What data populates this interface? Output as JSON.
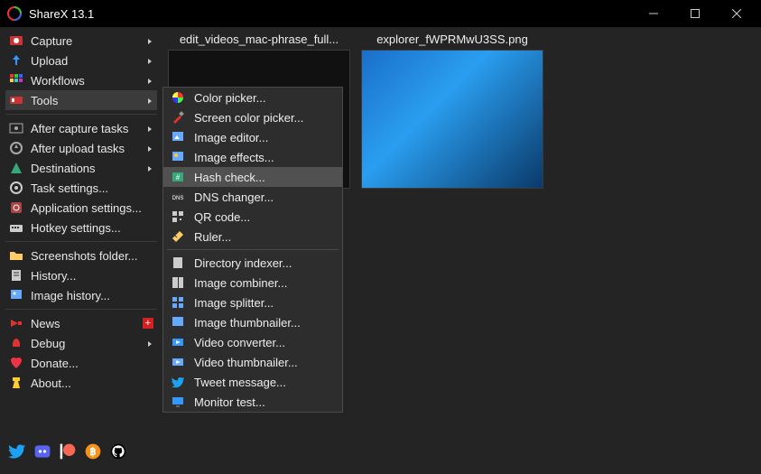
{
  "title": "ShareX 13.1",
  "sidebar": {
    "items": [
      {
        "label": "Capture",
        "icon": "capture",
        "arrow": true
      },
      {
        "label": "Upload",
        "icon": "upload",
        "arrow": true
      },
      {
        "label": "Workflows",
        "icon": "workflows",
        "arrow": true
      },
      {
        "label": "Tools",
        "icon": "tools",
        "arrow": true,
        "hover": true
      }
    ],
    "items2": [
      {
        "label": "After capture tasks",
        "icon": "aftercap",
        "arrow": true
      },
      {
        "label": "After upload tasks",
        "icon": "afterup",
        "arrow": true
      },
      {
        "label": "Destinations",
        "icon": "dest",
        "arrow": true
      },
      {
        "label": "Task settings...",
        "icon": "task",
        "arrow": false
      },
      {
        "label": "Application settings...",
        "icon": "app",
        "arrow": false
      },
      {
        "label": "Hotkey settings...",
        "icon": "hotkey",
        "arrow": false
      }
    ],
    "items3": [
      {
        "label": "Screenshots folder...",
        "icon": "folder",
        "arrow": false
      },
      {
        "label": "History...",
        "icon": "history",
        "arrow": false
      },
      {
        "label": "Image history...",
        "icon": "imghist",
        "arrow": false
      }
    ],
    "items4": [
      {
        "label": "News",
        "icon": "news",
        "arrow": false,
        "badge": "+"
      },
      {
        "label": "Debug",
        "icon": "debug",
        "arrow": true
      },
      {
        "label": "Donate...",
        "icon": "donate",
        "arrow": false
      },
      {
        "label": "About...",
        "icon": "about",
        "arrow": false
      }
    ]
  },
  "submenu": {
    "items": [
      {
        "label": "Color picker...",
        "icon": "colorwheel"
      },
      {
        "label": "Screen color picker...",
        "icon": "pipette"
      },
      {
        "label": "Image editor...",
        "icon": "editor"
      },
      {
        "label": "Image effects...",
        "icon": "effects"
      },
      {
        "label": "Hash check...",
        "icon": "hash",
        "hover": true
      },
      {
        "label": "DNS changer...",
        "icon": "dns"
      },
      {
        "label": "QR code...",
        "icon": "qr"
      },
      {
        "label": "Ruler...",
        "icon": "ruler"
      }
    ],
    "items2": [
      {
        "label": "Directory indexer...",
        "icon": "dir"
      },
      {
        "label": "Image combiner...",
        "icon": "combine"
      },
      {
        "label": "Image splitter...",
        "icon": "split"
      },
      {
        "label": "Image thumbnailer...",
        "icon": "thumb"
      },
      {
        "label": "Video converter...",
        "icon": "video"
      },
      {
        "label": "Video thumbnailer...",
        "icon": "vthumb"
      },
      {
        "label": "Tweet message...",
        "icon": "tweet"
      },
      {
        "label": "Monitor test...",
        "icon": "monitor"
      }
    ]
  },
  "thumbs": [
    {
      "caption": "edit_videos_mac-phrase_full...",
      "empty": true
    },
    {
      "caption": "explorer_fWPRMwU3SS.png",
      "empty": false
    }
  ]
}
